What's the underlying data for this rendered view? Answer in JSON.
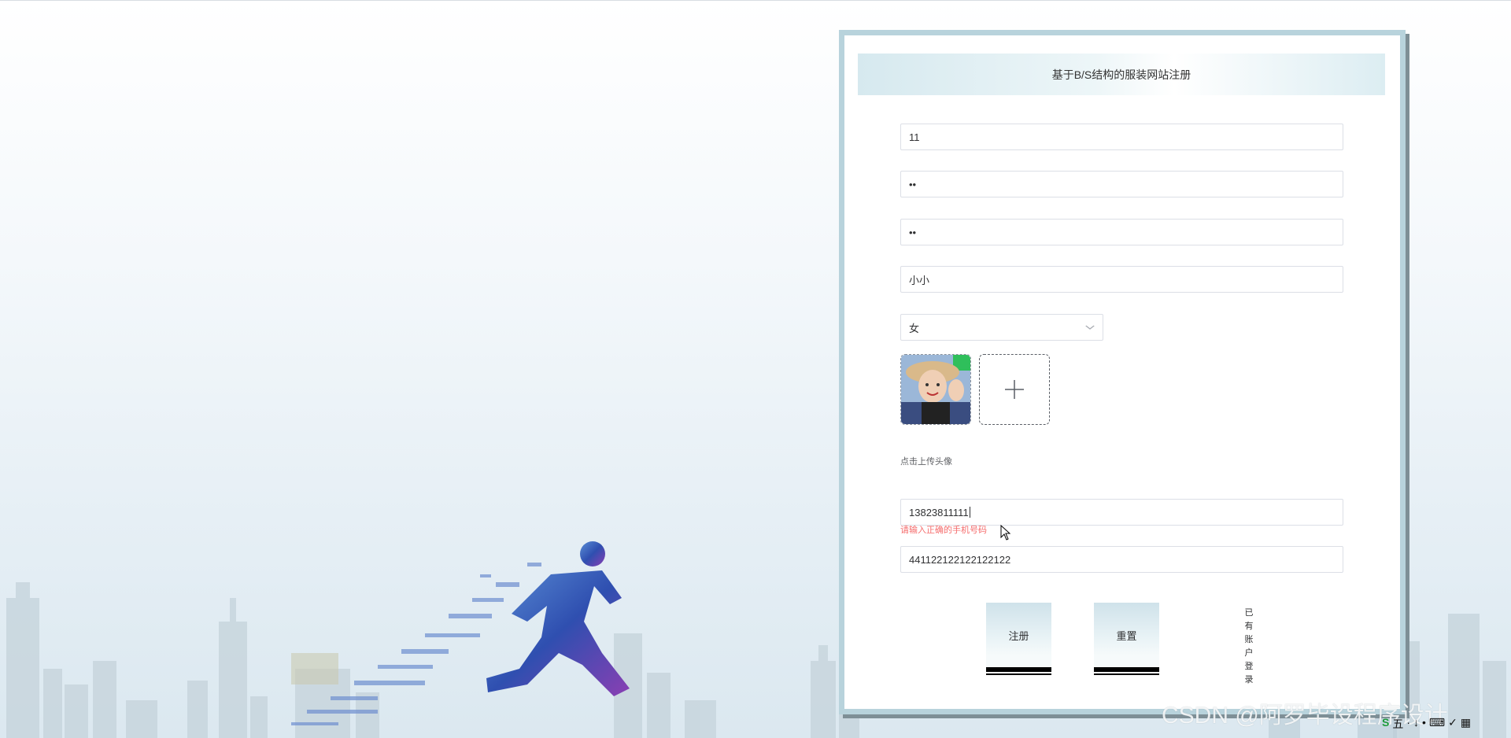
{
  "page": {
    "title": "基于B/S结构的服装网站注册"
  },
  "form": {
    "account": "11",
    "password": "••",
    "confirm_password": "••",
    "name": "小小",
    "gender": "女",
    "upload_tip": "点击上传头像",
    "phone": "13823811111",
    "phone_error": "请输入正确的手机号码",
    "id_card": "441122122122122122"
  },
  "buttons": {
    "register": "注册",
    "reset": "重置",
    "login_link": "已有账户登录"
  },
  "watermark": "CSDN @阿罗毕设程序设计",
  "tray": {
    "ime": "五",
    "items": [
      "·",
      "↓",
      "•",
      "⌨",
      "✓",
      "▦"
    ]
  },
  "colors": {
    "card_border": "#b8d3dc",
    "error": "#f56c6c",
    "button_bottom": "#000000"
  },
  "icons": {
    "gender_select": "chevron-down-icon",
    "uploader": "plus-icon",
    "ime": "s-logo-icon"
  }
}
